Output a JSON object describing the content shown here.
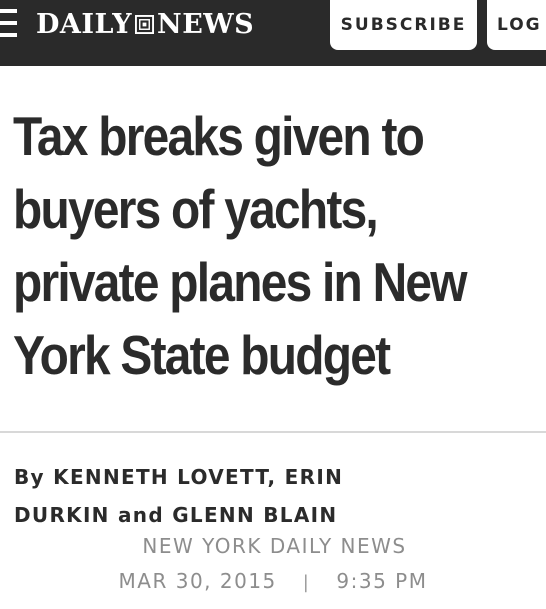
{
  "header": {
    "logo_left": "DAILY",
    "logo_right": "NEWS",
    "subscribe_label": "SUBSCRIBE",
    "login_label": "LOG",
    "background_color": "#2a2a2a",
    "icons": [
      "menu-icon",
      "logo-seal-icon"
    ]
  },
  "article": {
    "headline_lines": [
      "Tax breaks given to",
      "buyers of yachts,",
      "private planes in New",
      "York State budget"
    ],
    "byline_lines": [
      "By KENNETH LOVETT, ERIN",
      "DURKIN and GLENN BLAIN"
    ],
    "source": "NEW YORK DAILY NEWS",
    "date": "MAR 30, 2015",
    "separator": "|",
    "time": "9:35 PM"
  }
}
